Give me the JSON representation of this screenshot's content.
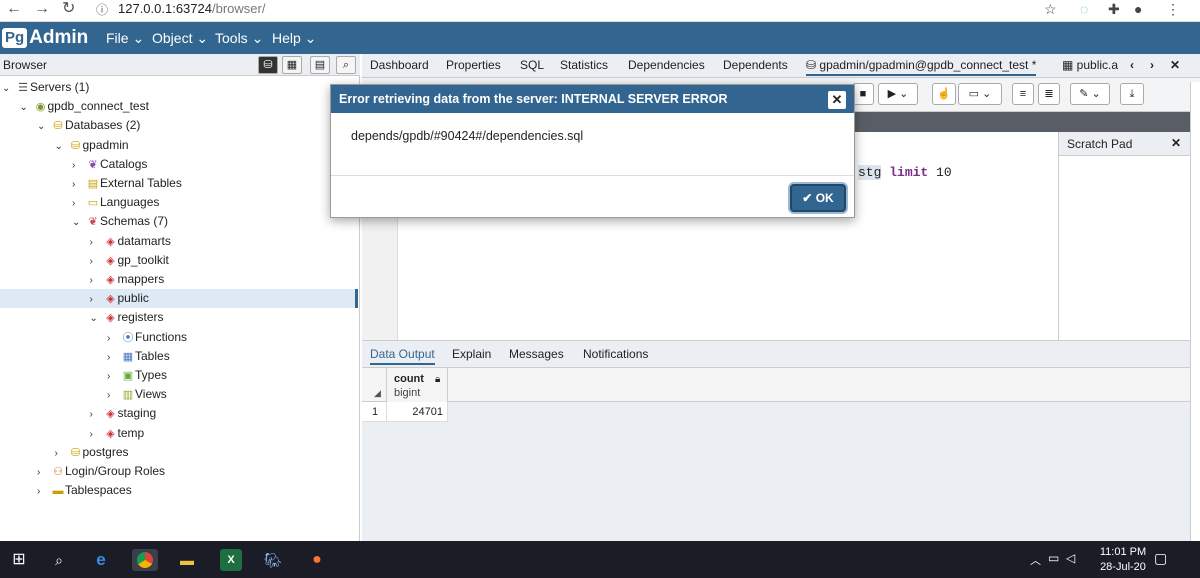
{
  "browser_chrome": {
    "url_host": "127.0.0.1:63724",
    "url_path": "/browser/"
  },
  "navbar": {
    "logo_pg": "Pg",
    "logo_admin": "Admin",
    "menus": [
      "File",
      "Object",
      "Tools",
      "Help"
    ]
  },
  "browser_panel": {
    "title": "Browser"
  },
  "tree": [
    {
      "label": "Servers (1)",
      "level": 0,
      "icon": "server-group-icon",
      "expanded": true
    },
    {
      "label": "gpdb_connect_test",
      "level": 1,
      "icon": "server-icon",
      "expanded": true
    },
    {
      "label": "Databases (2)",
      "level": 2,
      "icon": "databases-icon",
      "expanded": true
    },
    {
      "label": "gpadmin",
      "level": 3,
      "icon": "database-icon",
      "expanded": true
    },
    {
      "label": "Catalogs",
      "level": 4,
      "icon": "catalogs-icon",
      "expanded": false
    },
    {
      "label": "External Tables",
      "level": 4,
      "icon": "external-tables-icon",
      "expanded": false
    },
    {
      "label": "Languages",
      "level": 4,
      "icon": "languages-icon",
      "expanded": false
    },
    {
      "label": "Schemas (7)",
      "level": 4,
      "icon": "schemas-icon",
      "expanded": true
    },
    {
      "label": "datamarts",
      "level": 5,
      "icon": "schema-icon",
      "expanded": false
    },
    {
      "label": "gp_toolkit",
      "level": 5,
      "icon": "schema-icon",
      "expanded": false
    },
    {
      "label": "mappers",
      "level": 5,
      "icon": "schema-icon",
      "expanded": false
    },
    {
      "label": "public",
      "level": 5,
      "icon": "schema-icon",
      "expanded": false,
      "selected": true
    },
    {
      "label": "registers",
      "level": 5,
      "icon": "schema-icon",
      "expanded": true
    },
    {
      "label": "Functions",
      "level": 6,
      "icon": "functions-icon",
      "expanded": false
    },
    {
      "label": "Tables",
      "level": 6,
      "icon": "tables-icon",
      "expanded": false
    },
    {
      "label": "Types",
      "level": 6,
      "icon": "types-icon",
      "expanded": false
    },
    {
      "label": "Views",
      "level": 6,
      "icon": "views-icon",
      "expanded": false
    },
    {
      "label": "staging",
      "level": 5,
      "icon": "schema-icon",
      "expanded": false
    },
    {
      "label": "temp",
      "level": 5,
      "icon": "schema-icon",
      "expanded": false
    },
    {
      "label": "postgres",
      "level": 3,
      "icon": "database-icon",
      "expanded": false
    },
    {
      "label": "Login/Group Roles",
      "level": 2,
      "icon": "roles-icon",
      "expanded": false
    },
    {
      "label": "Tablespaces",
      "level": 2,
      "icon": "tablespaces-icon",
      "expanded": false
    }
  ],
  "tabs": [
    "Dashboard",
    "Properties",
    "SQL",
    "Statistics",
    "Dependencies",
    "Dependents",
    "gpadmin/gpadmin@gpdb_connect_test *",
    "public.a"
  ],
  "editor": {
    "sql_fragment_table": "stg",
    "sql_keyword_limit": "limit",
    "sql_number": "10"
  },
  "scratch_pad": {
    "title": "Scratch Pad"
  },
  "result_tabs": [
    "Data Output",
    "Explain",
    "Messages",
    "Notifications"
  ],
  "grid": {
    "column_name": "count",
    "column_type": "bigint",
    "rows": [
      {
        "num": "1",
        "value": "24701"
      }
    ]
  },
  "modal": {
    "title": "Error retrieving data from the server: INTERNAL SERVER ERROR",
    "message": "depends/gpdb/#90424#/dependencies.sql",
    "ok_label": "OK"
  },
  "taskbar": {
    "time": "11:01 PM",
    "date": "28-Jul-20"
  },
  "colors": {
    "brand": "#326690",
    "taskbar": "#1a1d25"
  }
}
